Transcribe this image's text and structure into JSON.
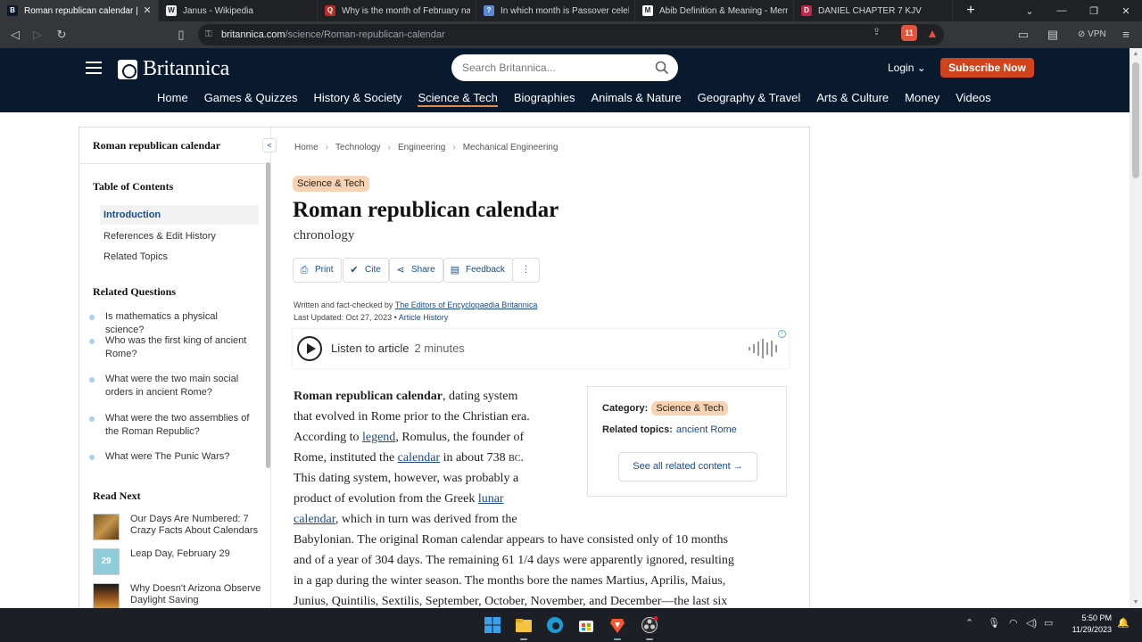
{
  "browser": {
    "tabs": [
      {
        "title": "Roman republican calendar | Britannica",
        "icon": "britannica-favicon",
        "color": "#0a1a2e",
        "glyph": "B"
      },
      {
        "title": "Janus - Wikipedia",
        "icon": "wikipedia-favicon",
        "color": "#eeeeee",
        "glyph": "W"
      },
      {
        "title": "Why is the month of February named",
        "icon": "quora-favicon",
        "color": "#b92b27",
        "glyph": "Q"
      },
      {
        "title": "In which month is Passover celebrated",
        "icon": "page-favicon",
        "color": "#5a8ad6",
        "glyph": "?"
      },
      {
        "title": "Abib Definition & Meaning - Merriam",
        "icon": "merriam-webster-favicon",
        "color": "#ffffff",
        "glyph": "M"
      },
      {
        "title": "DANIEL CHAPTER 7 KJV",
        "icon": "kjv-favicon",
        "color": "#c0284a",
        "glyph": "D"
      }
    ],
    "url_domain": "britannica.com",
    "url_path": "/science/Roman-republican-calendar",
    "vpn_label": "VPN"
  },
  "header": {
    "logo": "Britannica",
    "search_placeholder": "Search Britannica...",
    "login": "Login",
    "subscribe": "Subscribe Now",
    "nav": [
      "Home",
      "Games & Quizzes",
      "History & Society",
      "Science & Tech",
      "Biographies",
      "Animals & Nature",
      "Geography & Travel",
      "Arts & Culture",
      "Money",
      "Videos"
    ],
    "current_nav": "Science & Tech"
  },
  "sidebar": {
    "title": "Roman republican calendar",
    "toc_heading": "Table of Contents",
    "toc": [
      "Introduction",
      "References & Edit History",
      "Related Topics"
    ],
    "related_heading": "Related Questions",
    "questions": [
      "Is mathematics a physical science?",
      "Who was the first king of ancient Rome?",
      "What were the two main social orders in ancient Rome?",
      "What were the two assemblies of the Roman Republic?",
      "What were The Punic Wars?"
    ],
    "read_next_heading": "Read Next",
    "read_next": [
      "Our Days Are Numbered: 7 Crazy Facts About Calendars",
      "Leap Day, February 29",
      "Why Doesn't Arizona Observe Daylight Saving"
    ],
    "leap_day_number": "29"
  },
  "article": {
    "breadcrumbs": [
      "Home",
      "Technology",
      "Engineering",
      "Mechanical Engineering"
    ],
    "tag": "Science & Tech",
    "title": "Roman republican calendar",
    "subtitle": "chronology",
    "tools": {
      "print": "Print",
      "cite": "Cite",
      "share": "Share",
      "feedback": "Feedback"
    },
    "byline_prefix": "Written and fact-checked by",
    "byline_author": "The Editors of Encyclopaedia Britannica",
    "updated": "Last Updated: Oct 27, 2023 •",
    "history_link": "Article History",
    "listen_label": "Listen to article",
    "listen_duration": "2 minutes",
    "text": {
      "l1_bold": "Roman republican calendar",
      "l1_rest": ", dating system",
      "l2": "that evolved in Rome prior to the Christian era.",
      "l3_a": "According to ",
      "l3_link": "legend",
      "l3_b": ", Romulus, the founder of",
      "l4_a": "Rome, instituted the ",
      "l4_link": "calendar",
      "l4_b": " in about 738 ",
      "l4_era": "BC",
      "l4_c": ".",
      "l5": "This dating system, however, was probably a",
      "l6_a": "product of evolution from the Greek ",
      "l6_link": "lunar",
      "l7_link": "calendar",
      "l7_b": ", which in turn was derived from the",
      "l8": "Babylonian. The original Roman calendar appears to have consisted only of 10 months",
      "l9": "and of a year of 304 days. The remaining 61 1/4 days were apparently ignored, resulting",
      "l10": "in a gap during the winter season. The months bore the names Martius, Aprilis, Maius,",
      "l11": "Junius, Quintilis, Sextilis, September, October, November, and December—the last six"
    },
    "category_label": "Category:",
    "category_value": "Science & Tech",
    "related_label": "Related topics:",
    "related_value": "ancient Rome",
    "see_all": "See all related content →"
  },
  "taskbar": {
    "time": "5:50 PM",
    "date": "11/29/2023"
  }
}
